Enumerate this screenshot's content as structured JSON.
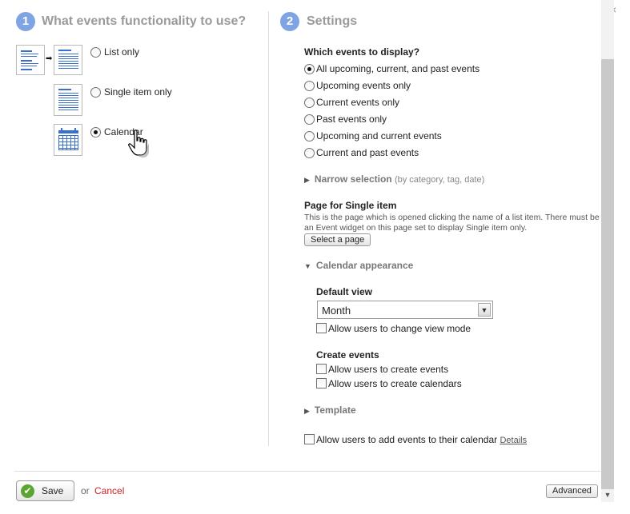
{
  "dialog": {
    "close_glyph": "×"
  },
  "step1": {
    "number": "1",
    "title": "What events functionality to use?",
    "options": [
      {
        "label": "List only",
        "checked": false,
        "icon": "list-to-detail-icon"
      },
      {
        "label": "Single item only",
        "checked": false,
        "icon": "single-item-icon"
      },
      {
        "label": "Calendar",
        "checked": true,
        "icon": "calendar-icon"
      }
    ]
  },
  "step2": {
    "number": "2",
    "title": "Settings",
    "display": {
      "heading": "Which events to display?",
      "options": [
        {
          "label": "All upcoming, current, and past events",
          "checked": true
        },
        {
          "label": "Upcoming events only",
          "checked": false
        },
        {
          "label": "Current events only",
          "checked": false
        },
        {
          "label": "Past events only",
          "checked": false
        },
        {
          "label": "Upcoming and current events",
          "checked": false
        },
        {
          "label": "Current and past events",
          "checked": false
        }
      ]
    },
    "narrow": {
      "label": "Narrow selection",
      "hint": "(by category, tag, date)"
    },
    "single_page": {
      "heading": "Page for Single item",
      "description": "This is the page which is opened clicking the name of a list item. There must be an Event widget on this page set to display Single item only.",
      "button": "Select a page"
    },
    "calendar_appearance": {
      "label": "Calendar appearance",
      "default_view_heading": "Default view",
      "default_view_value": "Month",
      "allow_change_view": "Allow users to change view mode",
      "create_heading": "Create events",
      "allow_create_events": "Allow users to create events",
      "allow_create_calendars": "Allow users to create calendars"
    },
    "template": {
      "label": "Template"
    },
    "add_to_calendar": {
      "label": "Allow users to add events to their calendar",
      "details_link": "Details"
    }
  },
  "footer": {
    "save": "Save",
    "or": "or",
    "cancel": "Cancel",
    "advanced": "Advanced"
  },
  "colors": {
    "step_circle": "#7fa4e3",
    "cancel": "#cc2222",
    "save_icon": "#5aa630"
  }
}
